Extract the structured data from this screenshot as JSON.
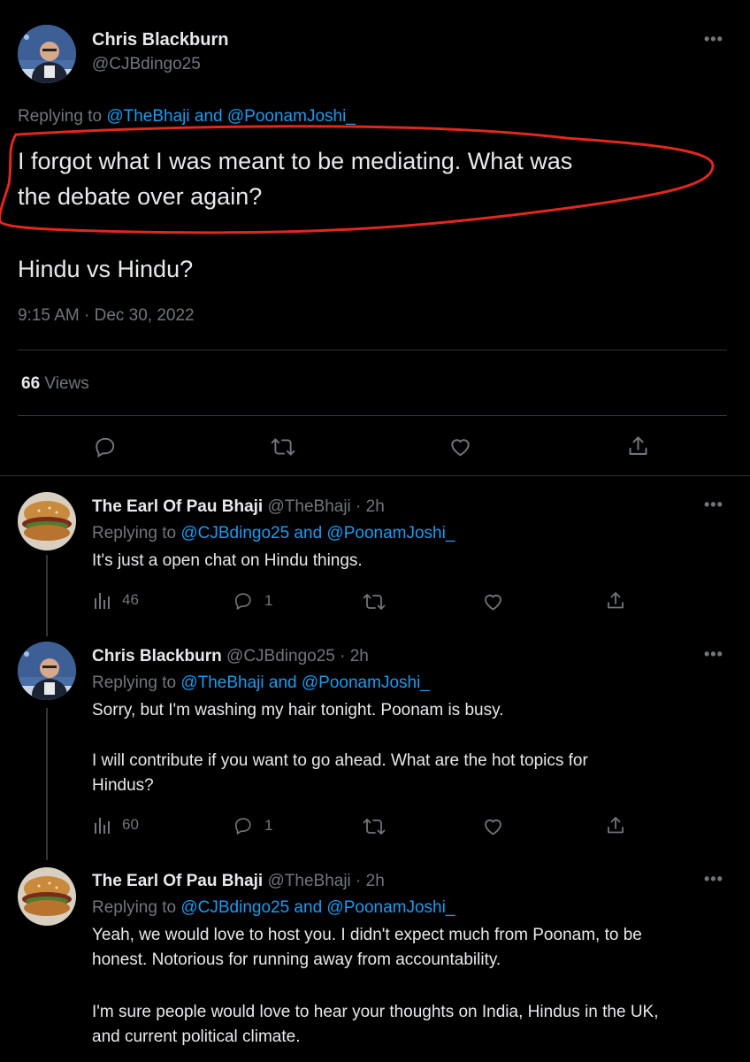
{
  "main_tweet": {
    "name": "Chris Blackburn",
    "handle": "@CJBdingo25",
    "replying_prefix": "Replying to ",
    "replying_to_1": "@TheBhaji",
    "replying_and": " and ",
    "replying_to_2": "@PoonamJoshi_",
    "text_line1": "I forgot what I was meant to be mediating. What was",
    "text_line2": "the debate over again?",
    "text_line3": "Hindu vs Hindu?",
    "timestamp": "9:15 AM · Dec 30, 2022",
    "views_count": "66",
    "views_label": " Views",
    "annotation_color": "#e0281e"
  },
  "replies": [
    {
      "name": "The Earl Of Pau Bhaji",
      "handle": "@TheBhaji",
      "time": " · 2h",
      "replying_prefix": "Replying to ",
      "replying_to_1": "@CJBdingo25",
      "replying_and": " and ",
      "replying_to_2": "@PoonamJoshi_",
      "text": "It's just a open chat on Hindu things.",
      "views": "46",
      "replies": "1"
    },
    {
      "name": "Chris Blackburn",
      "handle": "@CJBdingo25",
      "time": " · 2h",
      "replying_prefix": "Replying to ",
      "replying_to_1": "@TheBhaji",
      "replying_and": " and ",
      "replying_to_2": "@PoonamJoshi_",
      "text_p1": "Sorry, but I'm washing my hair tonight. Poonam is busy.",
      "text_p2_l1": "I will contribute if you want to go ahead. What are the hot topics for",
      "text_p2_l2": "Hindus?",
      "views": "60",
      "replies": "1"
    },
    {
      "name": "The Earl Of Pau Bhaji",
      "handle": "@TheBhaji",
      "time": " · 2h",
      "replying_prefix": "Replying to ",
      "replying_to_1": "@CJBdingo25",
      "replying_and": " and ",
      "replying_to_2": "@PoonamJoshi_",
      "text_p1_l1": "Yeah, we would love to host you. I didn't expect much from Poonam, to be",
      "text_p1_l2": "honest. Notorious for running away from accountability.",
      "text_p2_l1": "I'm sure people would love to hear your thoughts on India, Hindus in the UK,",
      "text_p2_l2": "and current political climate."
    }
  ],
  "icons": {
    "reply": "reply-icon",
    "retweet": "retweet-icon",
    "like": "heart-icon",
    "share": "share-icon",
    "views": "bar-chart-icon",
    "more": "more-icon"
  },
  "more_glyph": "•••",
  "colors": {
    "background": "#000000",
    "text": "#e7e9ea",
    "muted": "#71767b",
    "link": "#1d9bf0",
    "divider": "#2f3336"
  }
}
